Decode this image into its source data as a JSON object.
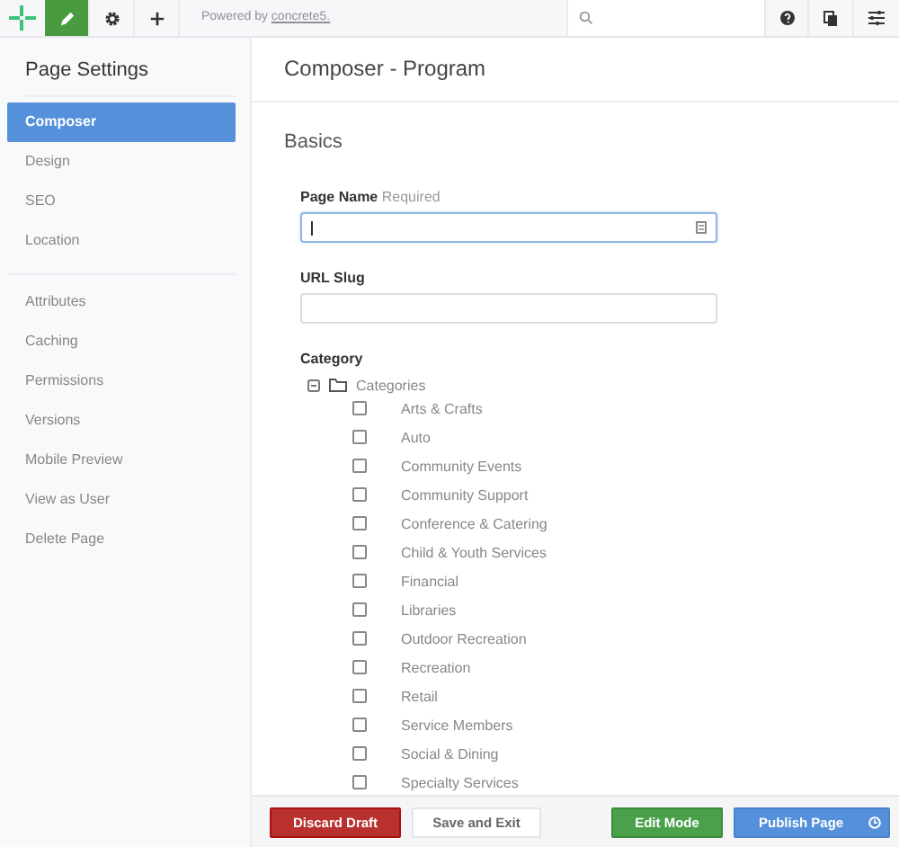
{
  "toolbar": {
    "buttons": [
      {
        "kind": "edit",
        "selected": true
      },
      {
        "kind": "settings",
        "selected": false
      },
      {
        "kind": "add",
        "selected": false
      }
    ],
    "powered_by": "Powered by",
    "powered_link": "concrete5."
  },
  "sidebar": {
    "title": "Page Settings",
    "groups": [
      [
        {
          "label": "Composer",
          "selected": true
        },
        {
          "label": "Design",
          "selected": false
        },
        {
          "label": "SEO",
          "selected": false
        },
        {
          "label": "Location",
          "selected": false
        }
      ],
      [
        {
          "label": "Attributes",
          "selected": false
        },
        {
          "label": "Caching",
          "selected": false
        },
        {
          "label": "Permissions",
          "selected": false
        },
        {
          "label": "Versions",
          "selected": false
        },
        {
          "label": "Mobile Preview",
          "selected": false
        },
        {
          "label": "View as User",
          "selected": false
        },
        {
          "label": "Delete Page",
          "selected": false
        }
      ]
    ]
  },
  "main": {
    "title": "Composer - Program",
    "section": "Basics",
    "fields": [
      {
        "label": "Page Name",
        "hint": "Required",
        "focused": true
      },
      {
        "label": "URL Slug",
        "focused": false
      }
    ],
    "category": {
      "label": "Category",
      "root": {
        "label": "Categories",
        "expanded": true,
        "children": [
          {
            "label": "Arts & Crafts",
            "checked": false
          },
          {
            "label": "Auto",
            "checked": false
          },
          {
            "label": "Community Events",
            "checked": false
          },
          {
            "label": "Community Support",
            "checked": false
          },
          {
            "label": "Conference & Catering",
            "checked": false
          },
          {
            "label": "Child & Youth Services",
            "checked": false
          },
          {
            "label": "Financial",
            "checked": false
          },
          {
            "label": "Libraries",
            "checked": false
          },
          {
            "label": "Outdoor Recreation",
            "checked": false
          },
          {
            "label": "Recreation",
            "checked": false
          },
          {
            "label": "Retail",
            "checked": false
          },
          {
            "label": "Service Members",
            "checked": false
          },
          {
            "label": "Social & Dining",
            "checked": false
          },
          {
            "label": "Specialty Services",
            "checked": false
          }
        ]
      }
    }
  },
  "actions": [
    {
      "kind": "danger",
      "label": "Discard Draft"
    },
    {
      "kind": "default",
      "label": "Save and Exit"
    },
    {
      "kind": "spacer"
    },
    {
      "kind": "success",
      "label": "Edit Mode"
    },
    {
      "kind": "primary",
      "label": "Publish Page"
    }
  ]
}
